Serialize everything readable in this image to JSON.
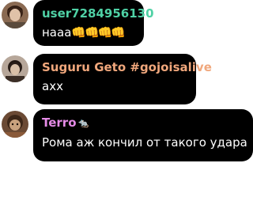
{
  "messages": [
    {
      "username": "user7284956130",
      "username_color": "#4fd1a5",
      "text": "нааа",
      "emoji": "👊👊👊👊"
    },
    {
      "username": "Suguru Geto #gojoisalive",
      "username_color": "#f0a77c",
      "text": "ахх"
    },
    {
      "username": "Terro",
      "username_badge": "🐀",
      "username_color": "#e58be6",
      "text": "Рома аж кончил от такого удара"
    }
  ]
}
